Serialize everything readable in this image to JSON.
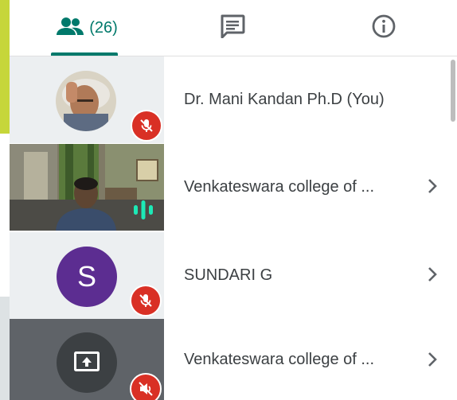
{
  "tabs": {
    "people_count": "(26)",
    "active": "people"
  },
  "participants": [
    {
      "name": "Dr. Mani Kandan Ph.D (You)",
      "mic": "muted",
      "tile": "photo"
    },
    {
      "name": "Venkateswara college of ...",
      "mic": "speaking",
      "tile": "video"
    },
    {
      "name": "SUNDARI G",
      "mic": "muted",
      "tile": "letter",
      "initial": "S"
    },
    {
      "name": "Venkateswara college of ...",
      "mic": "muted",
      "tile": "presentation"
    }
  ],
  "colors": {
    "accent": "#00796b",
    "muted_badge": "#d93025",
    "speaking": "#1de9b6",
    "letter_avatar": "#5c2d91",
    "presentation_tile": "#5f6368"
  }
}
